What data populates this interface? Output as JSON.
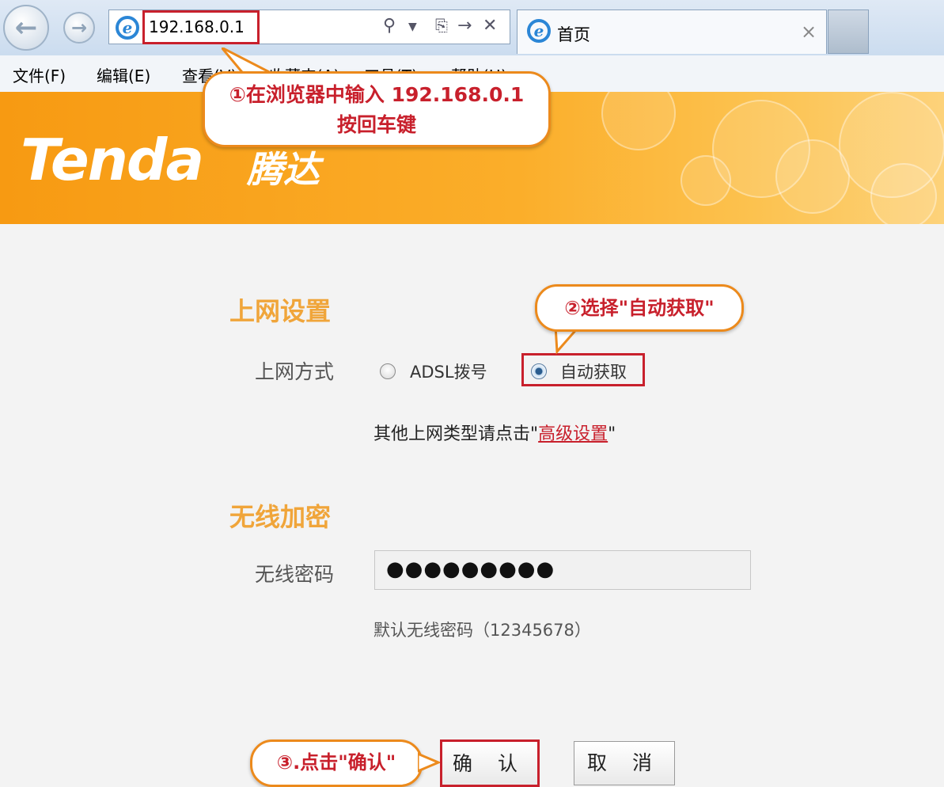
{
  "browser": {
    "address": "192.168.0.1",
    "tab_title": "首页",
    "tab_close": "×",
    "menu": [
      "文件(F)",
      "编辑(E)",
      "查看(V)",
      "收藏夹(A)",
      "工具(T)",
      "帮助(H)"
    ]
  },
  "brand": {
    "logo_text": "Tenda",
    "logo_cn": "腾达"
  },
  "annotations": {
    "step1_line1": "①在浏览器中输入 192.168.0.1",
    "step1_line2": "按回车键",
    "step2": "②选择\"自动获取\"",
    "step3": "③.点击\"确认\""
  },
  "internet": {
    "section_title": "上网设置",
    "mode_label": "上网方式",
    "option_adsl": "ADSL拨号",
    "option_auto": "自动获取",
    "selected": "自动获取",
    "hint_prefix": "其他上网类型请点击",
    "hint_quote_open": "\"",
    "advanced_link": "高级设置",
    "hint_quote_close": "\""
  },
  "wireless": {
    "section_title": "无线加密",
    "password_label": "无线密码",
    "password_masked": "●●●●●●●●●",
    "default_hint": "默认无线密码（12345678）"
  },
  "actions": {
    "confirm": "确 认",
    "cancel": "取 消"
  },
  "colors": {
    "accent_orange": "#f0a53a",
    "highlight_red": "#c8202c",
    "banner": "#f79a12"
  }
}
